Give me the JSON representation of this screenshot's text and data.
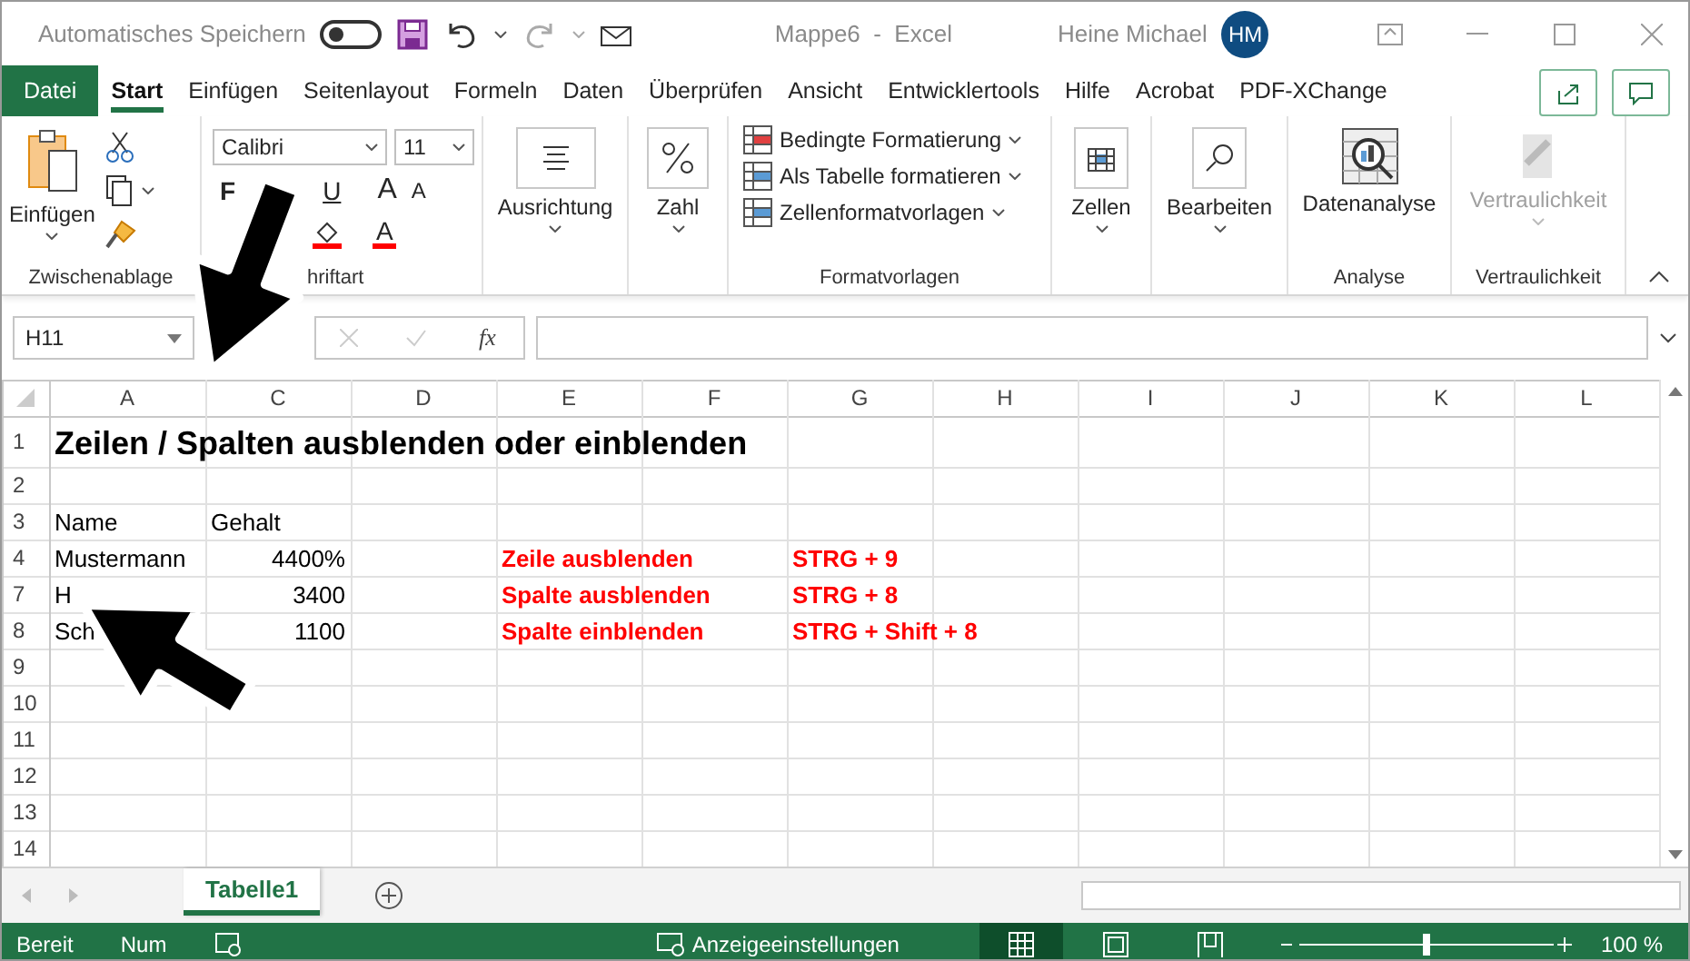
{
  "title_bar": {
    "autosave_label": "Automatisches Speichern",
    "autosave_on": false,
    "title": "Mappe6  -  Excel",
    "user": "Heine Michael",
    "initials": "HM"
  },
  "tabs": [
    {
      "label": "Datei",
      "kind": "file",
      "selected": false
    },
    {
      "label": "Start",
      "kind": "tab",
      "selected": true
    },
    {
      "label": "Einfügen",
      "kind": "tab",
      "selected": false
    },
    {
      "label": "Seitenlayout",
      "kind": "tab",
      "selected": false
    },
    {
      "label": "Formeln",
      "kind": "tab",
      "selected": false
    },
    {
      "label": "Daten",
      "kind": "tab",
      "selected": false
    },
    {
      "label": "Überprüfen",
      "kind": "tab",
      "selected": false
    },
    {
      "label": "Ansicht",
      "kind": "tab",
      "selected": false
    },
    {
      "label": "Entwicklertools",
      "kind": "tab",
      "selected": false
    },
    {
      "label": "Hilfe",
      "kind": "tab",
      "selected": false
    },
    {
      "label": "Acrobat",
      "kind": "tab",
      "selected": false
    },
    {
      "label": "PDF-XChange",
      "kind": "tab",
      "selected": false
    }
  ],
  "ribbon": {
    "clipboard": {
      "paste": "Einfügen",
      "label": "Zwischenablage"
    },
    "font": {
      "family": "Calibri",
      "size": "11",
      "bold": "F",
      "underline": "U",
      "grow": "A",
      "shrink": "A",
      "font_color_label": "A",
      "label": "hriftart"
    },
    "alignment": "Ausrichtung",
    "number": "Zahl",
    "styles": {
      "items": [
        "Bedingte Formatierung",
        "Als Tabelle formatieren",
        "Zellenformatvorlagen"
      ],
      "label": "Formatvorlagen"
    },
    "cells": "Zellen",
    "editing": "Bearbeiten",
    "analysis": {
      "button": "Datenanalyse",
      "label": "Analyse"
    },
    "sensitivity": {
      "button": "Vertraulichkeit",
      "disabled": true,
      "label": "Vertraulichkeit"
    }
  },
  "formula_bar": {
    "name_box": "H11",
    "function_label": "fx"
  },
  "sheet": {
    "columns": [
      "A",
      "C",
      "D",
      "E",
      "F",
      "G",
      "H",
      "I",
      "J",
      "K",
      "L"
    ],
    "rows": [
      {
        "header": "1",
        "kind": "tall",
        "cells": [
          {
            "text": "Zeilen / Spalten ausblenden oder einblenden",
            "kind": "title"
          }
        ]
      },
      {
        "header": "2",
        "kind": "normal",
        "cells": []
      },
      {
        "header": "3",
        "kind": "normal",
        "cells": [
          {
            "text": "Name",
            "kind": "text"
          },
          {
            "text": "Gehalt",
            "kind": "text"
          }
        ]
      },
      {
        "header": "4",
        "kind": "normal",
        "cells": [
          {
            "text": "Mustermann",
            "kind": "text"
          },
          {
            "text": "4400%",
            "kind": "number"
          },
          {
            "text": "",
            "kind": "empty"
          },
          {
            "text": "Zeile ausblenden",
            "kind": "red"
          },
          {
            "text": "",
            "kind": "empty"
          },
          {
            "text": "STRG + 9",
            "kind": "red"
          }
        ]
      },
      {
        "header": "7",
        "kind": "normal",
        "cells": [
          {
            "text": "H",
            "kind": "text"
          },
          {
            "text": "3400",
            "kind": "number"
          },
          {
            "text": "",
            "kind": "empty"
          },
          {
            "text": "Spalte ausblenden",
            "kind": "red"
          },
          {
            "text": "",
            "kind": "empty"
          },
          {
            "text": "STRG + 8",
            "kind": "red"
          }
        ]
      },
      {
        "header": "8",
        "kind": "normal",
        "cells": [
          {
            "text": "Sch",
            "kind": "text"
          },
          {
            "text": "1100",
            "kind": "number"
          },
          {
            "text": "",
            "kind": "empty"
          },
          {
            "text": "Spalte einblenden",
            "kind": "red"
          },
          {
            "text": "",
            "kind": "empty"
          },
          {
            "text": "STRG + Shift + 8",
            "kind": "red"
          }
        ]
      },
      {
        "header": "9",
        "kind": "normal",
        "cells": []
      },
      {
        "header": "10",
        "kind": "normal",
        "cells": []
      },
      {
        "header": "11",
        "kind": "normal",
        "cells": []
      },
      {
        "header": "12",
        "kind": "normal",
        "cells": []
      },
      {
        "header": "13",
        "kind": "normal",
        "cells": []
      },
      {
        "header": "14",
        "kind": "normal",
        "cells": []
      }
    ]
  },
  "sheet_tabs": [
    {
      "label": "Tabelle1",
      "selected": true
    }
  ],
  "status_bar": {
    "mode": "Bereit",
    "num": "Num",
    "display_settings": "Anzeigeeinstellungen",
    "views": [
      {
        "kind": "normal",
        "selected": true
      },
      {
        "kind": "page",
        "selected": false
      },
      {
        "kind": "break",
        "selected": false
      }
    ],
    "zoom": {
      "level": 0.5,
      "reading": "100 %"
    }
  }
}
